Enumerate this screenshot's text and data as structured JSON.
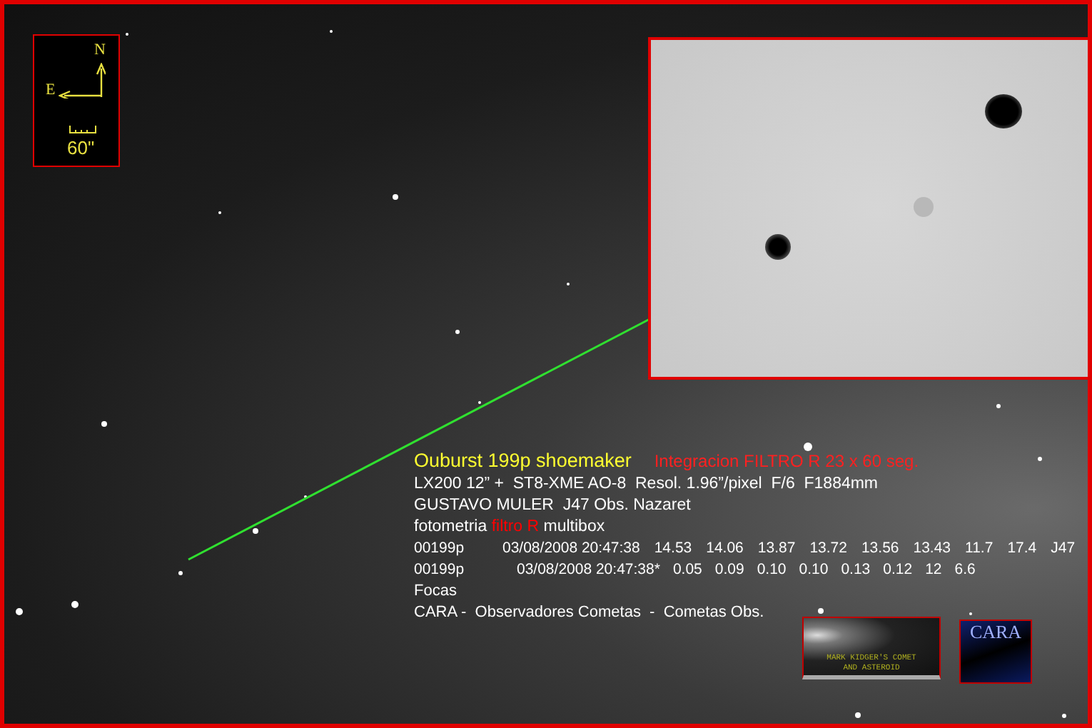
{
  "compass": {
    "north": "N",
    "east": "E",
    "scale": "60\""
  },
  "caption": {
    "title": "Ouburst 199p shoemaker",
    "integration": "Integracion FILTRO R 23 x 60 seg.",
    "lines": [
      [
        {
          "text": "LX200 12” +  ST8-XME AO-8  Resol. 1.96”/pixel  F/6  F1884mm",
          "color": "#ffffff"
        }
      ],
      [
        {
          "text": "GUSTAVO MULER  J47 Obs. Nazaret",
          "color": "#ffffff"
        }
      ],
      [
        {
          "text": "fotometria",
          "color": "#ffffff"
        },
        {
          "text": "filtro R",
          "color": "#ff0000"
        },
        {
          "text": "multibox",
          "color": "#ffffff"
        }
      ]
    ],
    "data_rows": [
      [
        "00199p",
        "03/08/2008 20:47:38",
        "14.53",
        "14.06",
        "13.87",
        "13.72",
        "13.56",
        "13.43",
        "11.7",
        "17.4",
        "J47"
      ],
      [
        "00199p",
        "03/08/2008 20:47:38*",
        "0.05",
        "0.09",
        "0.10",
        "0.10",
        "0.13",
        "0.12",
        "12",
        "6.6"
      ]
    ],
    "footer": [
      "Focas",
      "CARA -  Observadores Cometas  -  Cometas Obs."
    ]
  },
  "logos": {
    "kidger": [
      "MARK KIDGER'S COMET",
      "AND ASTEROID"
    ],
    "cara": "CARA"
  }
}
